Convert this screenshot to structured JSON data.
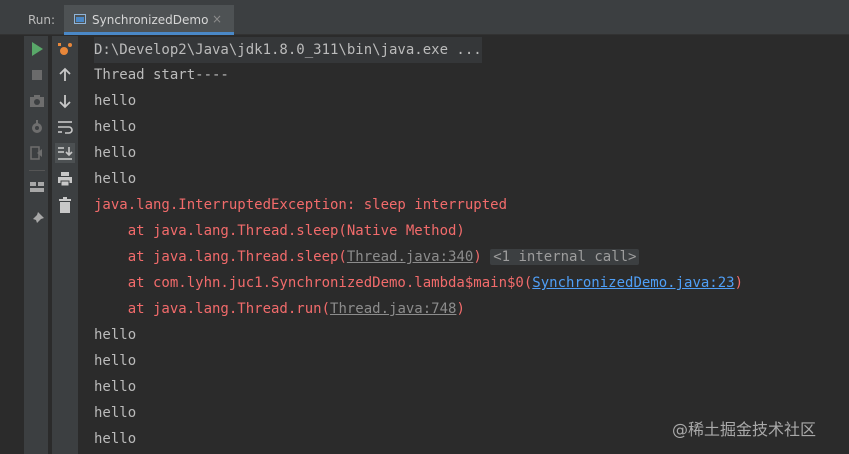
{
  "run_panel": {
    "label": "Run:",
    "tab_title": "SynchronizedDemo",
    "tab_close": "×"
  },
  "toolbar": {
    "left": [
      "rerun-icon",
      "stop-icon",
      "camera-icon",
      "debug-gear-icon",
      "exit-icon",
      "layout-icon",
      "pin-icon"
    ],
    "right": [
      "sweep-icon",
      "arrow-up-icon",
      "arrow-down-icon",
      "soft-wrap-icon",
      "scroll-to-end-icon",
      "print-icon",
      "trash-icon"
    ]
  },
  "console": {
    "command": "D:\\Develop2\\Java\\jdk1.8.0_311\\bin\\java.exe ...",
    "output": [
      "Thread start----",
      "hello",
      "hello",
      "hello",
      "hello"
    ],
    "exception": {
      "header": "java.lang.InterruptedException: sleep interrupted",
      "frame1": "    at java.lang.Thread.sleep(Native Method)",
      "frame2_prefix": "    at java.lang.Thread.sleep(",
      "frame2_link": "Thread.java:340",
      "frame2_suffix": ")",
      "frame2_fold": "<1 internal call>",
      "frame3_prefix": "    at com.lyhn.juc1.SynchronizedDemo.lambda$main$0(",
      "frame3_link": "SynchronizedDemo.java:23",
      "frame3_suffix": ")",
      "frame4_prefix": "    at java.lang.Thread.run(",
      "frame4_link": "Thread.java:748",
      "frame4_suffix": ")"
    },
    "output_after": [
      "hello",
      "hello",
      "hello",
      "hello",
      "hello"
    ]
  },
  "colors": {
    "background": "#2b2b2b",
    "error": "#f26b6b",
    "link": "#4f9ff7",
    "text": "#bbbbbb"
  },
  "watermark": "@稀土掘金技术社区"
}
